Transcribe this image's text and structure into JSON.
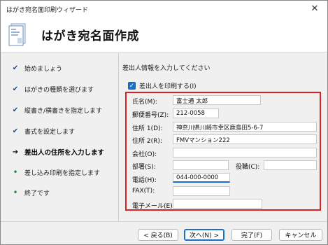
{
  "window": {
    "title": "はがき宛名面印刷ウィザード",
    "close_glyph": "✕"
  },
  "header": {
    "heading": "はがき宛名面作成"
  },
  "steps": [
    {
      "label": "始めましょう",
      "mark": "✔",
      "state": "done"
    },
    {
      "label": "はがきの種類を選びます",
      "mark": "✔",
      "state": "done"
    },
    {
      "label": "縦書き/横書きを指定します",
      "mark": "✔",
      "state": "done"
    },
    {
      "label": "書式を設定します",
      "mark": "✔",
      "state": "done"
    },
    {
      "label": "差出人の住所を入力します",
      "mark": "➔",
      "state": "current"
    },
    {
      "label": "差し込み印刷を指定します",
      "mark": "•",
      "state": "todo"
    },
    {
      "label": "終了です",
      "mark": "•",
      "state": "todo"
    }
  ],
  "content": {
    "instruction": "差出人情報を入力してください",
    "print_sender": {
      "label": "差出人を印刷する(I)",
      "checked": true,
      "glyph": "✓"
    },
    "fields": {
      "name": {
        "label": "氏名(M):",
        "value": "富士通 太郎"
      },
      "postal": {
        "label": "郵便番号(Z):",
        "value": "212-0058"
      },
      "address1": {
        "label": "住所 1(D):",
        "value": "神奈川県川崎市幸区鹿島田5-6-7"
      },
      "address2": {
        "label": "住所 2(R):",
        "value": "FMVマンション222"
      },
      "company": {
        "label": "会社(O):",
        "value": ""
      },
      "department": {
        "label": "部署(S):",
        "value": ""
      },
      "title": {
        "label": "役職(C):",
        "value": ""
      },
      "phone": {
        "label": "電話(H):",
        "value": "044-000-0000"
      },
      "fax": {
        "label": "FAX(T):",
        "value": ""
      },
      "email": {
        "label": "電子メール(E):",
        "value": ""
      }
    }
  },
  "buttons": {
    "back": "< 戻る(B)",
    "next": "次へ(N) >",
    "finish": "完了(F)",
    "cancel": "キャンセル"
  },
  "colors": {
    "highlight_box": "#e0201e",
    "accent": "#1a6fc9"
  }
}
